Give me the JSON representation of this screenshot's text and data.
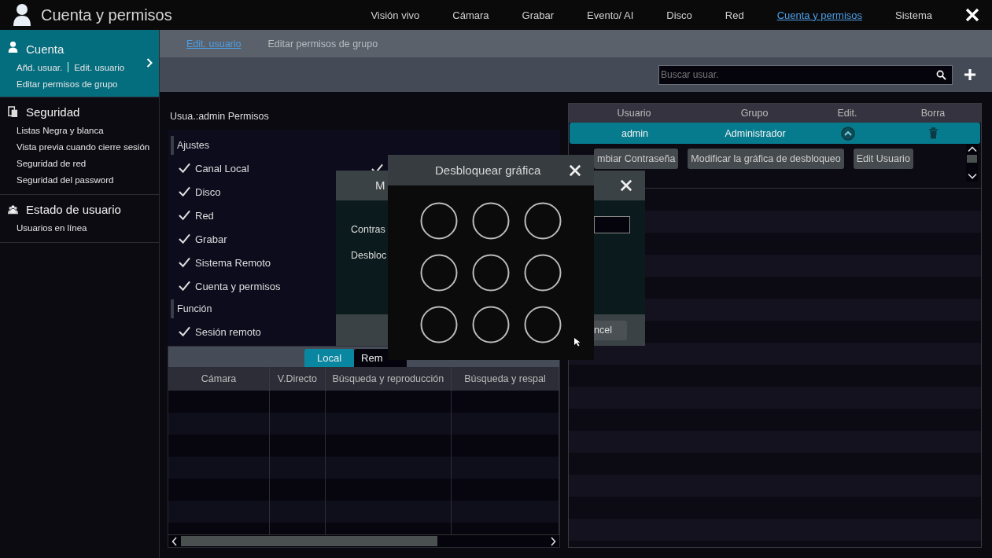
{
  "header": {
    "title": "Cuenta y permisos",
    "nav": [
      {
        "label": "Visión vivo",
        "selected": false
      },
      {
        "label": "Cámara",
        "selected": false
      },
      {
        "label": "Grabar",
        "selected": false
      },
      {
        "label": "Evento/ AI",
        "selected": false
      },
      {
        "label": "Disco",
        "selected": false
      },
      {
        "label": "Red",
        "selected": false
      },
      {
        "label": "Cuenta y permisos",
        "selected": true
      },
      {
        "label": "Sistema",
        "selected": false
      }
    ]
  },
  "sidebar": [
    {
      "title": "Cuenta",
      "kind": "user",
      "selected": true,
      "lines": [
        [
          "Añd. usuar.",
          "Edit. usuario"
        ],
        [
          "Editar permisos de grupo"
        ]
      ]
    },
    {
      "title": "Seguridad",
      "kind": "shield",
      "selected": false,
      "lines": [
        [
          "Listas Negra y blanca"
        ],
        [
          "Vista previa cuando cierre sesión"
        ],
        [
          "Seguridad de red"
        ],
        [
          "Seguridad del password"
        ]
      ]
    },
    {
      "title": "Estado de usuario",
      "kind": "group",
      "selected": false,
      "lines": [
        [
          "Usuarios en línea"
        ]
      ]
    }
  ],
  "subtabs": [
    {
      "label": "Edit. usuario",
      "selected": true
    },
    {
      "label": "Editar permisos de grupo",
      "selected": false
    }
  ],
  "search": {
    "placeholder": "Buscar usuar."
  },
  "permissions": {
    "title": "Usua.:admin Permisos",
    "groups": [
      {
        "label": "Ajustes",
        "items": [
          {
            "label": "Canal Local",
            "checked": true
          },
          {
            "label": "Disco",
            "checked": true
          },
          {
            "label": "Red",
            "checked": true
          },
          {
            "label": "Grabar",
            "checked": true
          },
          {
            "label": "Sistema Remoto",
            "checked": true
          },
          {
            "label": "Cuenta y permisos",
            "checked": true
          }
        ]
      },
      {
        "label": "Función",
        "items": [
          {
            "label": "Sesión remoto",
            "checked": true
          }
        ]
      }
    ],
    "column_2": [
      {
        "checked": true
      }
    ]
  },
  "permission_table": {
    "tabs": [
      {
        "label": "Local",
        "selected": true
      },
      {
        "label": "Rem",
        "selected": false
      }
    ],
    "columns": [
      "Cámara",
      "V.Directo",
      "Búsqueda y reproducción",
      "Búsqueda y respal"
    ]
  },
  "users": {
    "columns": [
      "Usuario",
      "Grupo",
      "Edit.",
      "Borra"
    ],
    "rows": [
      {
        "user": "admin",
        "group": "Administrador",
        "selected": true,
        "expanded": true
      }
    ],
    "actions": [
      "mbiar Contraseña",
      "Modificar la gráfica de desbloqueo",
      "Edit Usuario"
    ]
  },
  "dialog_back": {
    "title": "M",
    "fields": [
      "Contras",
      "Desbloc"
    ],
    "button": "ncel"
  },
  "dialog_pattern": {
    "title": "Desbloquear gráfica",
    "dots": [
      {
        "selected": false
      },
      {
        "selected": false
      },
      {
        "selected": false
      },
      {
        "selected": false
      },
      {
        "selected": false
      },
      {
        "selected": false
      },
      {
        "selected": false
      },
      {
        "selected": false
      },
      {
        "selected": false
      }
    ]
  }
}
